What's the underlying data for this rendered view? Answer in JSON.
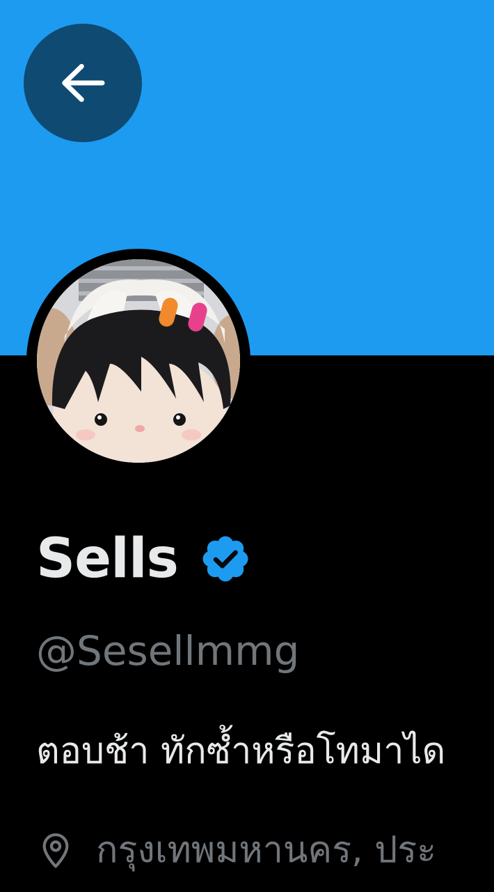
{
  "profile": {
    "display_name": "Sells",
    "handle": "@Sesellmmg",
    "bio": "ตอบช้า ทักซ้ำหรือโทมาได",
    "location": "กรุงเทพมหานคร, ประ",
    "verified": true
  },
  "icons": {
    "back": "arrow-left-icon",
    "verified": "verified-badge-icon",
    "location": "location-pin-icon"
  },
  "colors": {
    "banner": "#1d9bf0",
    "background": "#000000",
    "back_button": "#0f4a72",
    "primary_text": "#e7e9ea",
    "secondary_text": "#71767b",
    "verified_badge": "#1d9bf0"
  }
}
